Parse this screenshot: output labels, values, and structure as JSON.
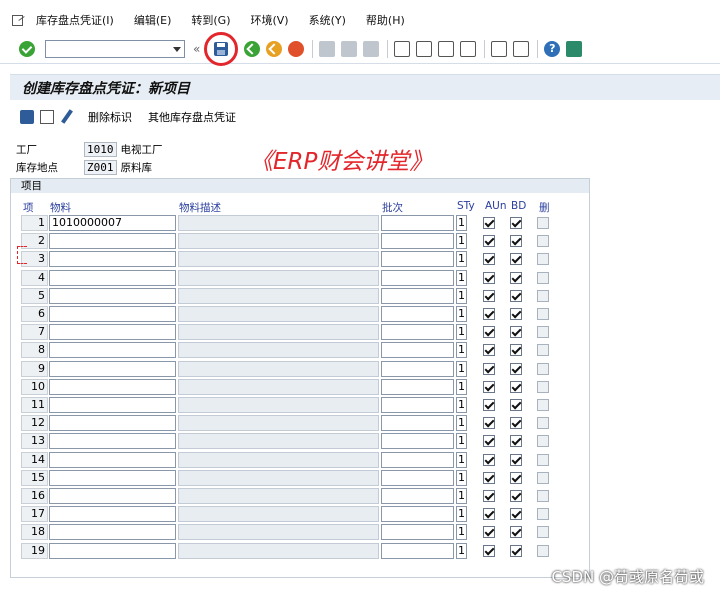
{
  "menubar": {
    "items": [
      "库存盘点凭证(I)",
      "编辑(E)",
      "转到(G)",
      "环境(V)",
      "系统(Y)",
      "帮助(H)"
    ]
  },
  "toolbar": {
    "command_value": ""
  },
  "title": "创建库存盘点凭证：新项目",
  "app_toolbar": {
    "delete_flag_label": "删除标识",
    "other_doc_label": "其他库存盘点凭证"
  },
  "header": {
    "plant_label": "工厂",
    "plant_value": "1010",
    "plant_desc": "电视工厂",
    "sloc_label": "库存地点",
    "sloc_value": "Z001",
    "sloc_desc": "原料库"
  },
  "watermark": "《ERP财会讲堂》",
  "items_group": {
    "title": "项目",
    "columns": [
      "项",
      "物料",
      "物料描述",
      "批次",
      "STy",
      "AUn",
      "BD",
      "删"
    ],
    "rows": [
      {
        "no": "1",
        "material": "1010000007",
        "desc": "",
        "batch": "",
        "sty": "1",
        "aun": true,
        "bd": true,
        "del": false
      },
      {
        "no": "2",
        "material": "",
        "desc": "",
        "batch": "",
        "sty": "1",
        "aun": true,
        "bd": true,
        "del": false
      },
      {
        "no": "3",
        "material": "",
        "desc": "",
        "batch": "",
        "sty": "1",
        "aun": true,
        "bd": true,
        "del": false
      },
      {
        "no": "4",
        "material": "",
        "desc": "",
        "batch": "",
        "sty": "1",
        "aun": true,
        "bd": true,
        "del": false
      },
      {
        "no": "5",
        "material": "",
        "desc": "",
        "batch": "",
        "sty": "1",
        "aun": true,
        "bd": true,
        "del": false
      },
      {
        "no": "6",
        "material": "",
        "desc": "",
        "batch": "",
        "sty": "1",
        "aun": true,
        "bd": true,
        "del": false
      },
      {
        "no": "7",
        "material": "",
        "desc": "",
        "batch": "",
        "sty": "1",
        "aun": true,
        "bd": true,
        "del": false
      },
      {
        "no": "8",
        "material": "",
        "desc": "",
        "batch": "",
        "sty": "1",
        "aun": true,
        "bd": true,
        "del": false
      },
      {
        "no": "9",
        "material": "",
        "desc": "",
        "batch": "",
        "sty": "1",
        "aun": true,
        "bd": true,
        "del": false
      },
      {
        "no": "10",
        "material": "",
        "desc": "",
        "batch": "",
        "sty": "1",
        "aun": true,
        "bd": true,
        "del": false
      },
      {
        "no": "11",
        "material": "",
        "desc": "",
        "batch": "",
        "sty": "1",
        "aun": true,
        "bd": true,
        "del": false
      },
      {
        "no": "12",
        "material": "",
        "desc": "",
        "batch": "",
        "sty": "1",
        "aun": true,
        "bd": true,
        "del": false
      },
      {
        "no": "13",
        "material": "",
        "desc": "",
        "batch": "",
        "sty": "1",
        "aun": true,
        "bd": true,
        "del": false
      },
      {
        "no": "14",
        "material": "",
        "desc": "",
        "batch": "",
        "sty": "1",
        "aun": true,
        "bd": true,
        "del": false
      },
      {
        "no": "15",
        "material": "",
        "desc": "",
        "batch": "",
        "sty": "1",
        "aun": true,
        "bd": true,
        "del": false
      },
      {
        "no": "16",
        "material": "",
        "desc": "",
        "batch": "",
        "sty": "1",
        "aun": true,
        "bd": true,
        "del": false
      },
      {
        "no": "17",
        "material": "",
        "desc": "",
        "batch": "",
        "sty": "1",
        "aun": true,
        "bd": true,
        "del": false
      },
      {
        "no": "18",
        "material": "",
        "desc": "",
        "batch": "",
        "sty": "1",
        "aun": true,
        "bd": true,
        "del": false
      },
      {
        "no": "19",
        "material": "",
        "desc": "",
        "batch": "",
        "sty": "1",
        "aun": true,
        "bd": true,
        "del": false
      }
    ]
  },
  "csdn_watermark": "CSDN @荀彧原名荀或",
  "colors": {
    "highlight_red": "#e3262b",
    "sap_blue": "#2e5c98",
    "header_bg": "#e6edf4"
  }
}
